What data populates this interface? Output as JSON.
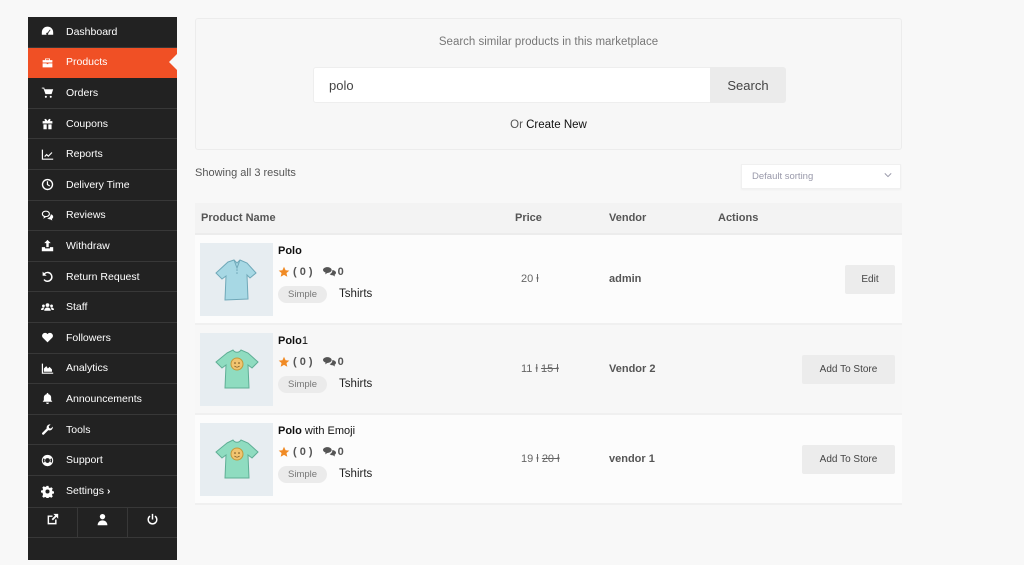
{
  "sidebar": {
    "items": [
      {
        "label": "Dashboard",
        "icon": "dashboard-icon"
      },
      {
        "label": "Products",
        "icon": "briefcase-icon",
        "active": true
      },
      {
        "label": "Orders",
        "icon": "cart-icon"
      },
      {
        "label": "Coupons",
        "icon": "gift-icon"
      },
      {
        "label": "Reports",
        "icon": "line-chart-icon"
      },
      {
        "label": "Delivery Time",
        "icon": "clock-icon"
      },
      {
        "label": "Reviews",
        "icon": "comments-icon"
      },
      {
        "label": "Withdraw",
        "icon": "upload-icon"
      },
      {
        "label": "Return Request",
        "icon": "undo-icon"
      },
      {
        "label": "Staff",
        "icon": "users-icon"
      },
      {
        "label": "Followers",
        "icon": "heart-icon"
      },
      {
        "label": "Analytics",
        "icon": "area-chart-icon"
      },
      {
        "label": "Announcements",
        "icon": "bell-icon"
      },
      {
        "label": "Tools",
        "icon": "wrench-icon"
      },
      {
        "label": "Support",
        "icon": "life-ring-icon"
      },
      {
        "label": "Settings",
        "icon": "gear-icon",
        "chevron": "›"
      }
    ],
    "bottom": [
      "external-link-icon",
      "user-icon",
      "power-icon"
    ]
  },
  "search": {
    "title": "Search similar products in this marketplace",
    "value": "polo",
    "button": "Search",
    "or_text": "Or",
    "create_new": "Create New"
  },
  "results": {
    "count_text": "Showing all 3 results",
    "sort_selected": "Default sorting"
  },
  "table": {
    "headers": {
      "name": "Product Name",
      "price": "Price",
      "vendor": "Vendor",
      "actions": "Actions"
    },
    "rows": [
      {
        "name_bold": "Polo",
        "name_rest": "",
        "rating": "( 0 )",
        "comments": "0",
        "type": "Simple",
        "category": "Tshirts",
        "price": "20 ⱡ",
        "old_price": "",
        "vendor": "admin",
        "action": "Edit",
        "thumb": "polo-shirt"
      },
      {
        "name_bold": "Polo",
        "name_rest": "1",
        "rating": "( 0 )",
        "comments": "0",
        "type": "Simple",
        "category": "Tshirts",
        "price": "11 ⱡ",
        "old_price": "15 ⱡ",
        "vendor": "Vendor 2",
        "action": "Add To Store",
        "thumb": "emoji-tshirt"
      },
      {
        "name_bold": "Polo",
        "name_rest": " with Emoji",
        "rating": "( 0 )",
        "comments": "0",
        "type": "Simple",
        "category": "Tshirts",
        "price": "19 ⱡ",
        "old_price": "20 ⱡ",
        "vendor": "vendor 1",
        "action": "Add To Store",
        "thumb": "emoji-tshirt"
      }
    ]
  },
  "colors": {
    "accent": "#f05025",
    "sidebar_bg": "#222222",
    "star": "#f08a24"
  }
}
